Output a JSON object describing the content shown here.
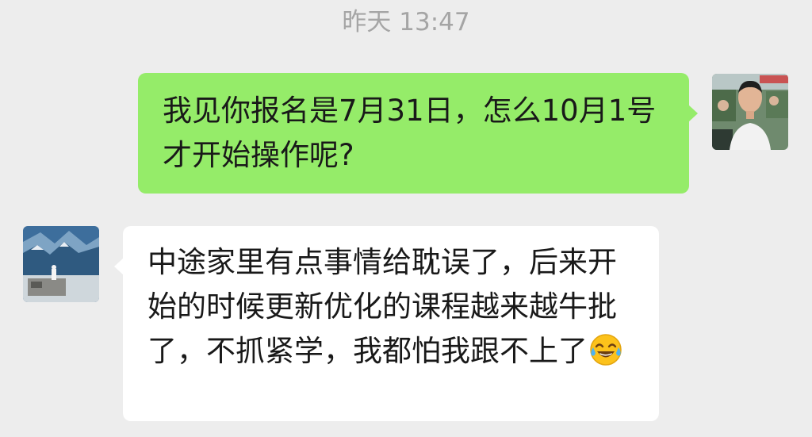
{
  "timestamp": "昨天 13:47",
  "messages": [
    {
      "sender": "self",
      "text": "我见你报名是7月31日，怎么10月1号才开始操作呢?"
    },
    {
      "sender": "other",
      "text": "中途家里有点事情给耽误了，后来开始的时候更新优化的课程越来越牛批了，不抓紧学，我都怕我跟不上了",
      "emoji": "tears-of-joy-emoji"
    }
  ],
  "colors": {
    "background": "#ededed",
    "self_bubble": "#95ec69",
    "other_bubble": "#ffffff",
    "timestamp_text": "#a5a5a5",
    "message_text": "#191919"
  }
}
